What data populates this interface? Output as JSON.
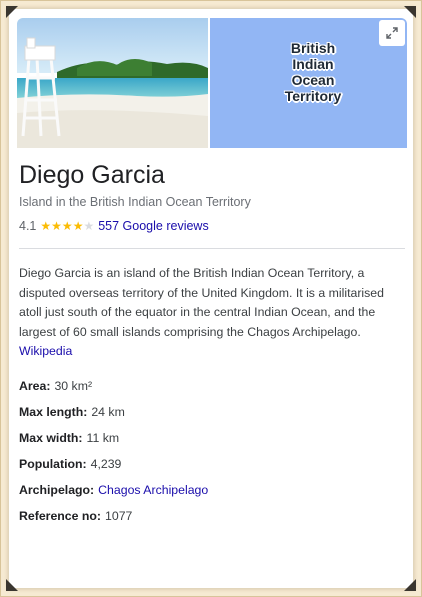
{
  "place": {
    "title": "Diego Garcia",
    "subtitle": "Island in the British Indian Ocean Territory",
    "rating": "4.1",
    "stars": [
      1,
      1,
      1,
      1,
      0
    ],
    "reviews_label": "557 Google reviews",
    "description": "Diego Garcia is an island of the British Indian Ocean Territory, a disputed overseas territory of the United Kingdom. It is a militarised atoll just south of the equator in the central Indian Ocean, and the largest of 60 small islands comprising the Chagos Archipelago.",
    "source_link": "Wikipedia"
  },
  "map": {
    "label_lines": [
      "British",
      "Indian",
      "Ocean",
      "Territory"
    ],
    "expand_icon": "expand-icon"
  },
  "facts": [
    {
      "key": "Area:",
      "value": "30 km²",
      "is_link": false
    },
    {
      "key": "Max length:",
      "value": "24 km",
      "is_link": false
    },
    {
      "key": "Max width:",
      "value": "11 km",
      "is_link": false
    },
    {
      "key": "Population:",
      "value": "4,239",
      "is_link": false
    },
    {
      "key": "Archipelago:",
      "value": "Chagos Archipelago",
      "is_link": true
    },
    {
      "key": "Reference no:",
      "value": "1077",
      "is_link": false
    }
  ],
  "colors": {
    "link": "#1a0dab",
    "star_filled": "#fbbc04",
    "star_empty": "#dadce0",
    "map_water": "#92b6f4"
  }
}
